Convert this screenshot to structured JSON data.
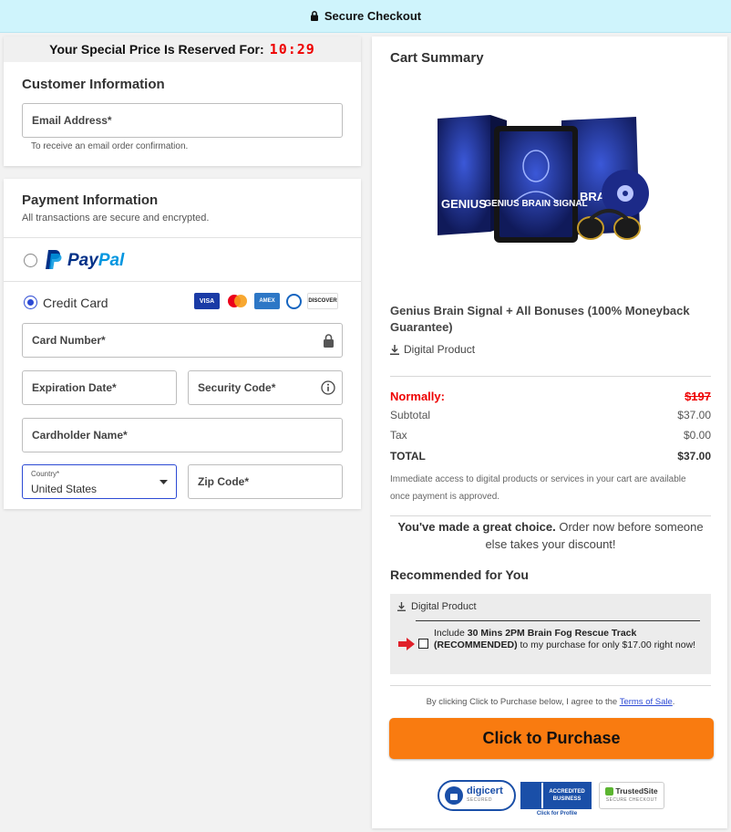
{
  "header": {
    "title": "Secure Checkout",
    "lock_icon": "lock-icon"
  },
  "timer": {
    "label": "Your Special Price Is Reserved For:",
    "time": "10:29"
  },
  "customer": {
    "title": "Customer Information",
    "email_label": "Email Address*",
    "email_helper": "To receive an email order confirmation."
  },
  "payment": {
    "title": "Payment Information",
    "subtitle": "All transactions are secure and encrypted.",
    "paypal": {
      "pay": "Pay",
      "pal": "Pal"
    },
    "credit_card_label": "Credit Card",
    "card_logos": [
      "VISA",
      "mastercard",
      "AMEX",
      "diners",
      "DISCOVER"
    ],
    "card_number": "Card Number*",
    "expiration": "Expiration Date*",
    "security_code": "Security Code*",
    "cardholder": "Cardholder Name*",
    "country_label": "Country*",
    "country_value": "United States",
    "zip": "Zip Code*"
  },
  "summary": {
    "title": "Cart Summary",
    "product_name": "Genius Brain Signal + All Bonuses (100% Moneyback Guarantee)",
    "product_type": "Digital Product",
    "image_text": {
      "box_left": "GENIUS",
      "tablet": "GENIUS BRAIN SIGNAL",
      "box_right": "BRA"
    },
    "normally_label": "Normally:",
    "normally_value": "$197",
    "subtotal_label": "Subtotal",
    "subtotal_value": "$37.00",
    "tax_label": "Tax",
    "tax_value": "$0.00",
    "total_label": "TOTAL",
    "total_value": "$37.00",
    "access_note": "Immediate access to digital products or services in your cart are available once payment is approved.",
    "choice_bold": "You've made a great choice.",
    "choice_rest": " Order now before someone else takes your discount!"
  },
  "recommended": {
    "title": "Recommended for You",
    "type": "Digital Product",
    "text_prefix": "Include ",
    "text_bold": "30 Mins 2PM Brain Fog Rescue Track (RECOMMENDED)",
    "text_suffix": " to my purchase for only $17.00 right now!"
  },
  "terms": {
    "prefix": "By clicking Click to Purchase below, I agree to the ",
    "link": "Terms of Sale",
    "suffix": "."
  },
  "purchase_button": "Click to Purchase",
  "badges": {
    "digicert": "digicert",
    "digicert_sub": "SECURED",
    "bbb_line1": "ACCREDITED",
    "bbb_line2": "BUSINESS",
    "bbb_sub": "Click for Profile",
    "trusted": "TrustedSite",
    "trusted_sub": "SECURE CHECKOUT"
  },
  "colors": {
    "accent": "#2c4ad4",
    "button": "#f97b10",
    "alert": "#e00000",
    "topbar": "#cff4fc"
  }
}
